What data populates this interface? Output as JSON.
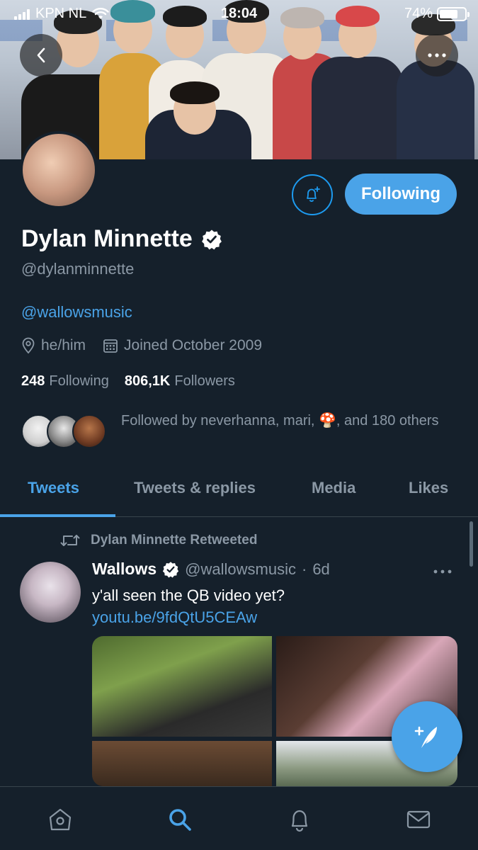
{
  "status_bar": {
    "carrier": "KPN NL",
    "time": "18:04",
    "battery": "74%",
    "battery_level": 0.74
  },
  "banner": {
    "back_icon": "chevron-left-icon",
    "more_icon": "more-horizontal-icon"
  },
  "profile": {
    "name": "Dylan Minnette",
    "handle": "@dylanminnette",
    "bio_link": "@wallowsmusic",
    "pronouns": "he/him",
    "joined": "Joined October 2009",
    "following_count": "248",
    "following_label": "Following",
    "followers_count": "806,1K",
    "followers_label": "Followers",
    "followed_by": "Followed by neverhanna, mari, 🍄, and 180 others",
    "follow_button": "Following"
  },
  "tabs": [
    {
      "label": "Tweets",
      "active": true
    },
    {
      "label": "Tweets & replies",
      "active": false
    },
    {
      "label": "Media",
      "active": false
    },
    {
      "label": "Likes",
      "active": false
    }
  ],
  "tweet": {
    "retweet_label": "Dylan Minnette Retweeted",
    "author_name": "Wallows",
    "author_handle": "@wallowsmusic",
    "time_sep": "·",
    "time": "6d",
    "text_prefix": "y'all seen the QB video yet? ",
    "link": "youtu.be/9fdQtU5CEAw"
  },
  "colors": {
    "background": "#15202b",
    "accent": "#4aa3e8",
    "secondary_text": "#8b98a5"
  }
}
